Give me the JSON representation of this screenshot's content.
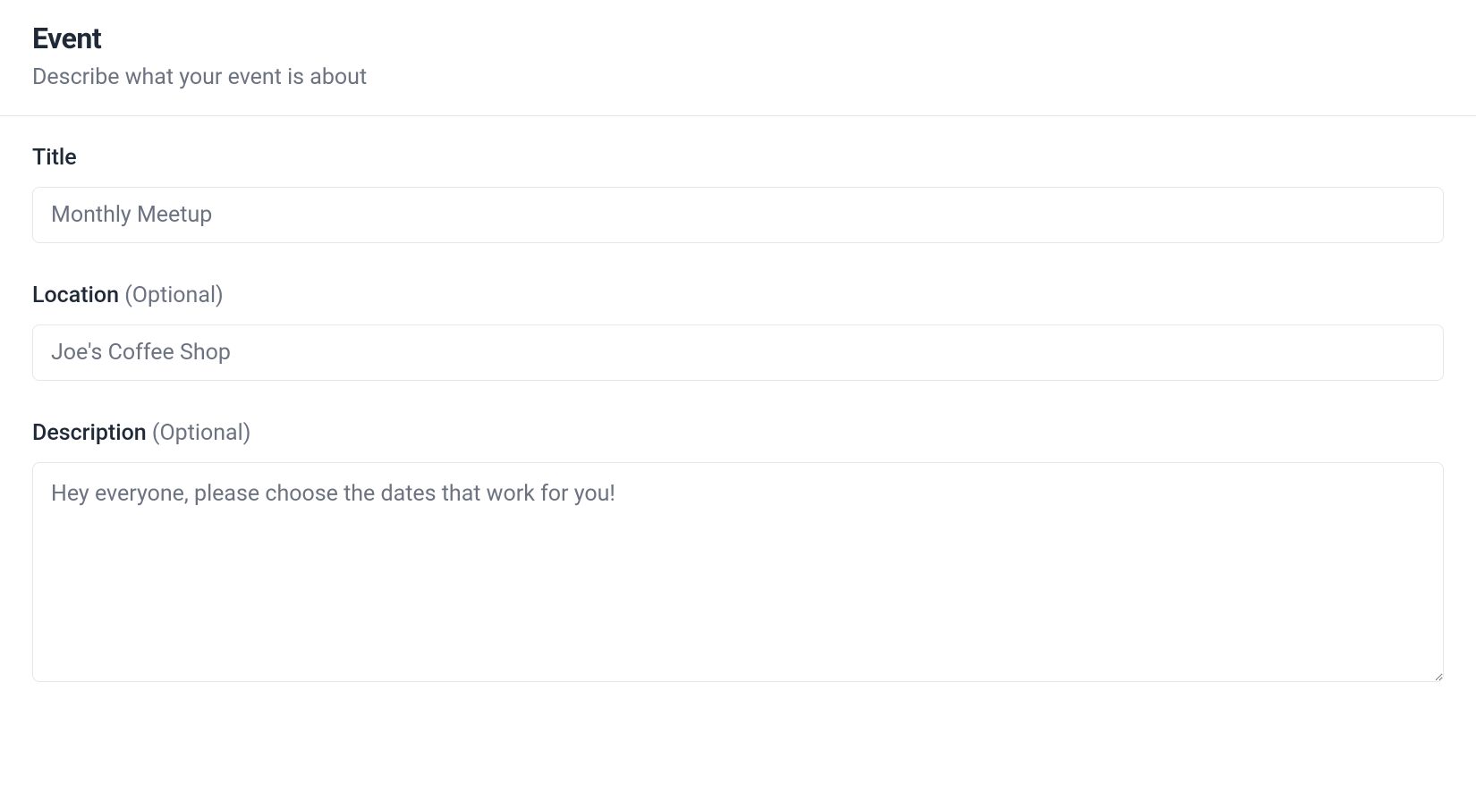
{
  "header": {
    "title": "Event",
    "subtitle": "Describe what your event is about"
  },
  "form": {
    "title": {
      "label": "Title",
      "placeholder": "Monthly Meetup",
      "value": ""
    },
    "location": {
      "label": "Location ",
      "optional": "(Optional)",
      "placeholder": "Joe's Coffee Shop",
      "value": ""
    },
    "description": {
      "label": "Description ",
      "optional": "(Optional)",
      "placeholder": "Hey everyone, please choose the dates that work for you!",
      "value": ""
    }
  }
}
